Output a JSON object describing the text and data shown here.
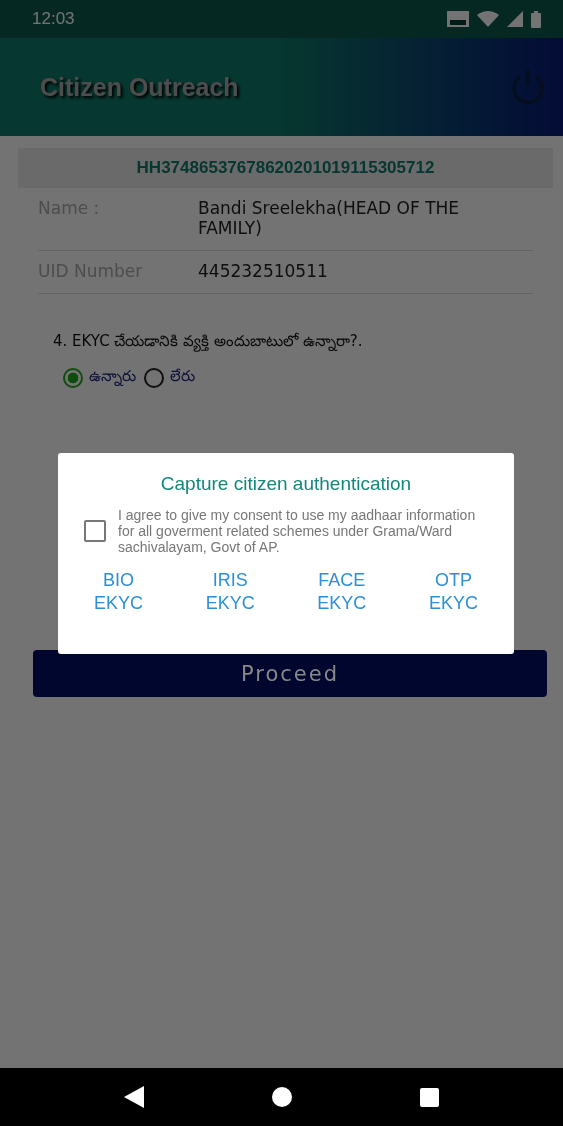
{
  "status_bar": {
    "time": "12:03"
  },
  "app_bar": {
    "title": "Citizen Outreach"
  },
  "household_id": "HH37486537678620201019115305712",
  "details": [
    {
      "label": "Name :",
      "value": "Bandi Sreelekha(HEAD OF THE FAMILY)"
    },
    {
      "label": "UID Number",
      "value": "445232510511"
    }
  ],
  "question": {
    "text": "4. EKYC చేయడానికి వ్యక్తి అందుబాటులో ఉన్నారా?.",
    "options": [
      {
        "label": "ఉన్నారు",
        "selected": true
      },
      {
        "label": "లేరు",
        "selected": false
      }
    ]
  },
  "proceed_button": "Proceed",
  "dialog": {
    "title": "Capture citizen authentication",
    "consent": {
      "text": "I agree to give my consent to use my aadhaar information for all goverment related schemes under Grama/Ward sachivalayam, Govt of AP.",
      "checked": false
    },
    "buttons": [
      [
        "BIO",
        "EKYC"
      ],
      [
        "IRIS",
        "EKYC"
      ],
      [
        "FACE",
        "EKYC"
      ],
      [
        "OTP",
        "EKYC"
      ]
    ]
  }
}
